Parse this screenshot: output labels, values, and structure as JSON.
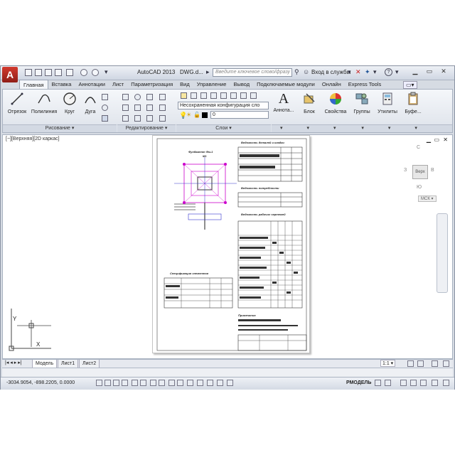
{
  "title_bar": {
    "app_title": "AutoCAD 2013",
    "doc_title": "DWG.d...",
    "search_placeholder": "Введите ключевое слово/фразу",
    "login_label": "Вход в службы",
    "help_label": "?",
    "logo_letter": "A"
  },
  "ribbon_tabs": [
    "Главная",
    "Вставка",
    "Аннотации",
    "Лист",
    "Параметризация",
    "Вид",
    "Управление",
    "Вывод",
    "Подключаемые модули",
    "Онлайн",
    "Express Tools"
  ],
  "ribbon": {
    "draw_tools": [
      "Отрезок",
      "Полилиния",
      "Круг",
      "Дуга"
    ],
    "panel_draw": "Рисование ▾",
    "panel_modify": "Редактирование ▾",
    "panel_layers": "Слои ▾",
    "layer_config": "Несохраненная конфигурация сло",
    "layer_current": "0",
    "big_buttons": [
      "Аннота...",
      "Блок",
      "Свойства",
      "Группы",
      "Утилиты",
      "Буфе..."
    ]
  },
  "viewport": {
    "view_label": "[−][Верхняя][2D каркас]",
    "cube_top": "Верх",
    "cube_n": "С",
    "cube_w": "З",
    "cube_e": "В",
    "cube_s": "Ю",
    "ucs_label": "МСК ▾",
    "axis_x": "X",
    "axis_y": "Y"
  },
  "sheet": {
    "title_top": "Ведомость деталей и кладки",
    "plan_title": "Фундамент Фм-1",
    "plan_sub": "М1",
    "table2_title": "Ведомость потребности",
    "table3_title": "Ведомость рабочих чертежей",
    "spec_title": "Спецификация элементов",
    "notes_title": "Примечания"
  },
  "bottom_tabs": [
    "Модель",
    "Лист1",
    "Лист2"
  ],
  "status_bar": {
    "coordinates": "-3034.9054, -898.2205, 0.0000",
    "mode_label": "РМОДЕЛЬ",
    "scale_label": "1:1 ▾"
  }
}
